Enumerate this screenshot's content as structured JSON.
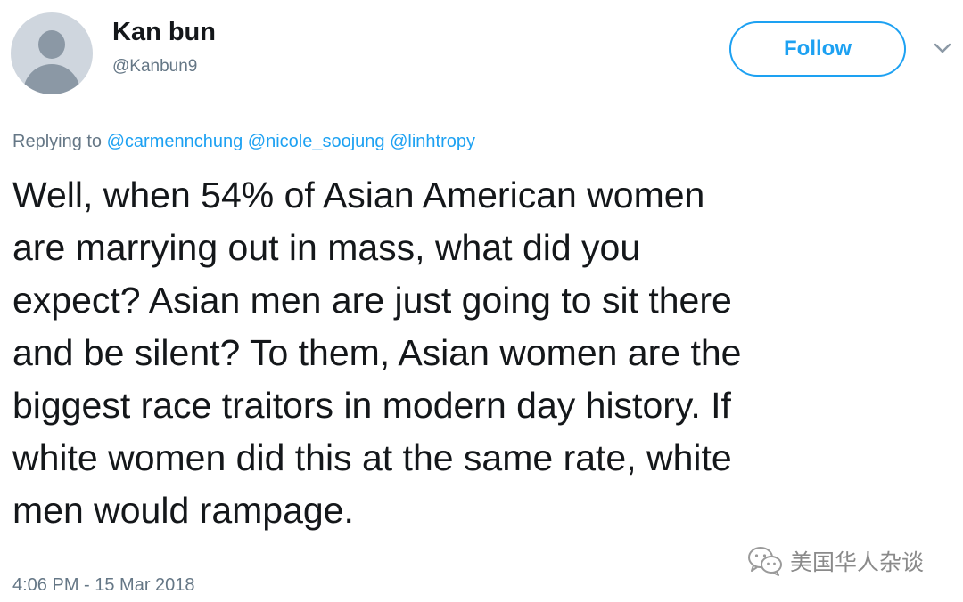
{
  "user": {
    "display_name": "Kan bun",
    "handle": "@Kanbun9"
  },
  "follow_label": "Follow",
  "reply": {
    "prefix": "Replying to",
    "mentions": [
      "@carmennchung",
      "@nicole_soojung",
      "@linhtropy"
    ]
  },
  "tweet_lines": [
    "Well, when 54% of Asian American women",
    "are marrying out in mass, what did you",
    "expect? Asian men are just going to sit there",
    "and be silent? To them, Asian women are the",
    "biggest race traitors in modern day history. If",
    "white women did this at the same rate, white",
    "men would rampage."
  ],
  "timestamp": "4:06 PM - 15 Mar 2018",
  "watermark": {
    "text": "美国华人杂谈",
    "icon": "wechat-icon"
  },
  "colors": {
    "accent": "#1da1f2",
    "secondary_text": "#657786",
    "primary_text": "#14171a"
  }
}
